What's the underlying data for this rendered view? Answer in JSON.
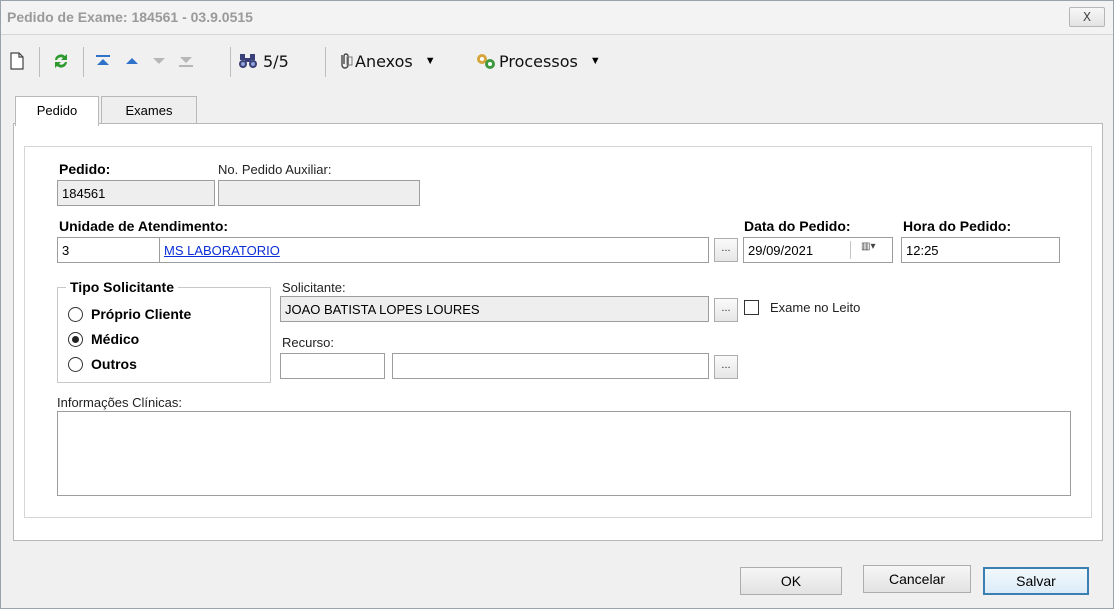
{
  "window": {
    "title": "Pedido de Exame: 184561 - 03.9.0515",
    "close_label": "X"
  },
  "toolbar": {
    "icons": [
      "new-document-icon",
      "refresh-icon",
      "first-record-icon",
      "previous-record-icon",
      "next-record-icon",
      "last-record-icon",
      "binoculars-icon"
    ],
    "record_position": "5/5",
    "attachments_label": "Anexos",
    "processes_label": "Processos"
  },
  "tabs": [
    {
      "label": "Pedido",
      "active": true
    },
    {
      "label": "Exames",
      "active": false
    }
  ],
  "form": {
    "pedido_label": "Pedido:",
    "pedido_value": "184561",
    "pedido_aux_label": "No. Pedido Auxiliar:",
    "pedido_aux_value": "",
    "unidade_label": "Unidade de Atendimento:",
    "unidade_code": "3",
    "unidade_name": "MS LABORATORIO",
    "data_label": "Data do Pedido:",
    "data_value": "29/09/2021",
    "hora_label": "Hora do Pedido:",
    "hora_value": "12:25",
    "tipo_solicitante_label": "Tipo Solicitante",
    "tipo_options": [
      {
        "label": "Próprio Cliente",
        "selected": false
      },
      {
        "label": "Médico",
        "selected": true
      },
      {
        "label": "Outros",
        "selected": false
      }
    ],
    "solicitante_label": "Solicitante:",
    "solicitante_value": "JOAO BATISTA LOPES LOURES",
    "recurso_label": "Recurso:",
    "recurso_code": "",
    "recurso_name": "",
    "exame_leito_label": "Exame no Leito",
    "exame_leito_checked": false,
    "info_clinicas_label": "Informações Clínicas:",
    "info_clinicas_value": "",
    "browse_label": "..."
  },
  "buttons": {
    "ok": "OK",
    "cancel": "Cancelar",
    "save": "Salvar"
  },
  "colors": {
    "link": "#0b2fd6",
    "default_button_border": "#3c7fb1",
    "refresh_green": "#2e9a2e",
    "nav_blue": "#2f73c8"
  }
}
